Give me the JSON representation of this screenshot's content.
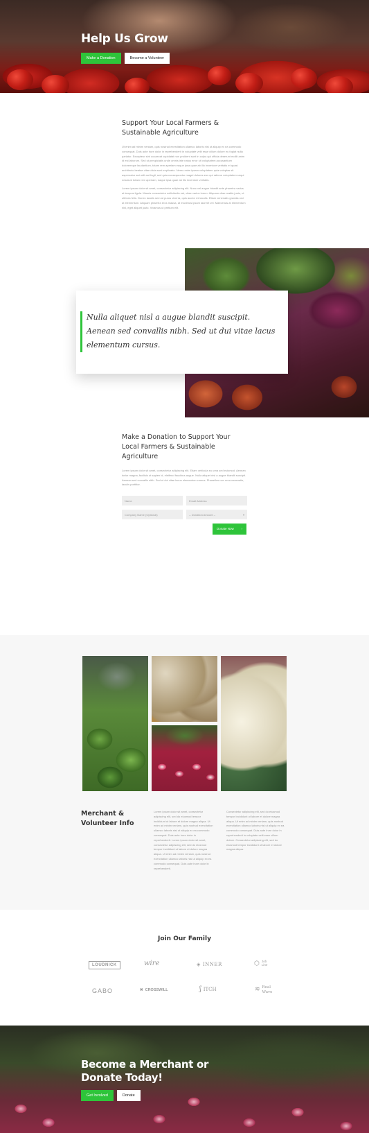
{
  "hero": {
    "title": "Help Us Grow",
    "primary_button": "Make a Donation",
    "secondary_button": "Become a Volunteer"
  },
  "support": {
    "title": "Support Your Local Farmers & Sustainable Agriculture",
    "paragraph_1": "Ut enim ad minim veniam, quis nostrud exercitation ullamco laboris nisi ut aliquip ex ea commodo consequat. Duis aute irure dolor in reprehenderit in voluptate velit esse cillum dolore eu fugiat nulla pariatur. Excepteur sint occaecat cupidatat non proident sunt in culpa qui officia deserunt mollit anim id est laborum. Sed ut perspiciatis unde omnis iste natus error sit voluptatem accusantium doloremque laudantium, totam rem aperiam eaque ipsa quae ab illo inventore veritatis et quasi architecto beatae vitae dicta sunt explicabo. Nemo enim ipsam voluptatem quia voluptas sit aspernatur aut odit aut fugit, sed quia consequuntur magni dolores eos qui ratione voluptatem sequi nesciunt totam rem aperiam, eaque ipsa quae ab illo inventore veritatis.",
    "paragraph_2": "Lorem ipsum dolor sit amet, consectetur adipiscing elit. Nunc vel augue blandit ante pharetra varius at tempus ligula. Mauris consectetur sollicitudin est, vitae varius lorem. Aliquam vitae mattis justo, ut ultrices felis. Donec iaculis sem at purus viverra, quis auctor mi iaculis. Etiam venenatis gravida orci at elementum. Aliquam pharetra eros massa, at maximus ipsum laoreet vel. Maecenas at elementum nisl, eget aliquet justo. Vivamus ut pretium elit."
  },
  "quote": {
    "text": "Nulla aliquet nisl a augue blandit suscipit. Aenean sed convallis nibh. Sed ut dui vitae lacus elementum cursus."
  },
  "donate": {
    "title": "Make a Donation to Support Your Local Farmers & Sustainable Agriculture",
    "paragraph": "Lorem ipsum dolor sit amet, consectetur adipiscing elit. Etiam vehicula eu urna sed euismod. Aenean tortor magna, facilisis ut sapien id, eleifend faucibus augue. Nulla aliquet nisl a augue blandit suscipit. Aenean sed convallis nibh. Sed ut dui vitae lacus elementum cursus. Phasellus non urna venenatis, iaculis porttitor.",
    "name_placeholder": "Name",
    "email_placeholder": "Email Address",
    "company_placeholder": "Company Name (Optional)",
    "amount_selected": "-- Donation Amount --",
    "submit_label": "Donate Now",
    "submit_arrow": "›"
  },
  "merchant": {
    "title": "Merchant & Volunteer Info",
    "col_1": "Lorem ipsum dolor sit amet, consectetur adipiscing elit, sed do eiusmod tempor incididunt ut labore et dolore magna aliqua. Ut enim ad minim veniam, quis nostrud exercitation ullamco laboris nisi ut aliquip ex ea commodo consequat. Duis aute irure dolor in reprehenderit. Lorem ipsum dolor sit amet, consectetur adipiscing elit, sed do eiusmod tempor incididunt ut labore et dolore magna aliqua. Ut enim ad minim veniam, quis nostrud exercitation ullamco laboris nisi ut aliquip ex ea commodo consequat. Duis aute irure dolor in reprehenderit.",
    "col_2": "Consectetur adipiscing elit, sed do eiusmod tempor incididunt ut labore et dolore magna aliqua. Ut enim ad minim veniam, quis nostrud exercitation ullamco laboris nisi ut aliquip ex ea commodo consequat. Duis aute irure dolor in reprehenderit in voluptate velit esse cillum dolore. Consectetur adipiscing elit, sed do eiusmod tempor incididunt ut labore et dolore magna aliqua."
  },
  "family": {
    "title": "Join Our Family",
    "logos": [
      "LOUDNICK",
      "wire",
      "INNER",
      "Job Line",
      "GABO",
      "CROSSWILL",
      "ITCH",
      "Real Wave"
    ]
  },
  "cta": {
    "title": "Become a Merchant or Donate Today!",
    "primary_button": "Get Involved",
    "secondary_button": "Donate"
  },
  "colors": {
    "accent_green": "#2ec43a",
    "section_gray": "#f7f7f7"
  }
}
